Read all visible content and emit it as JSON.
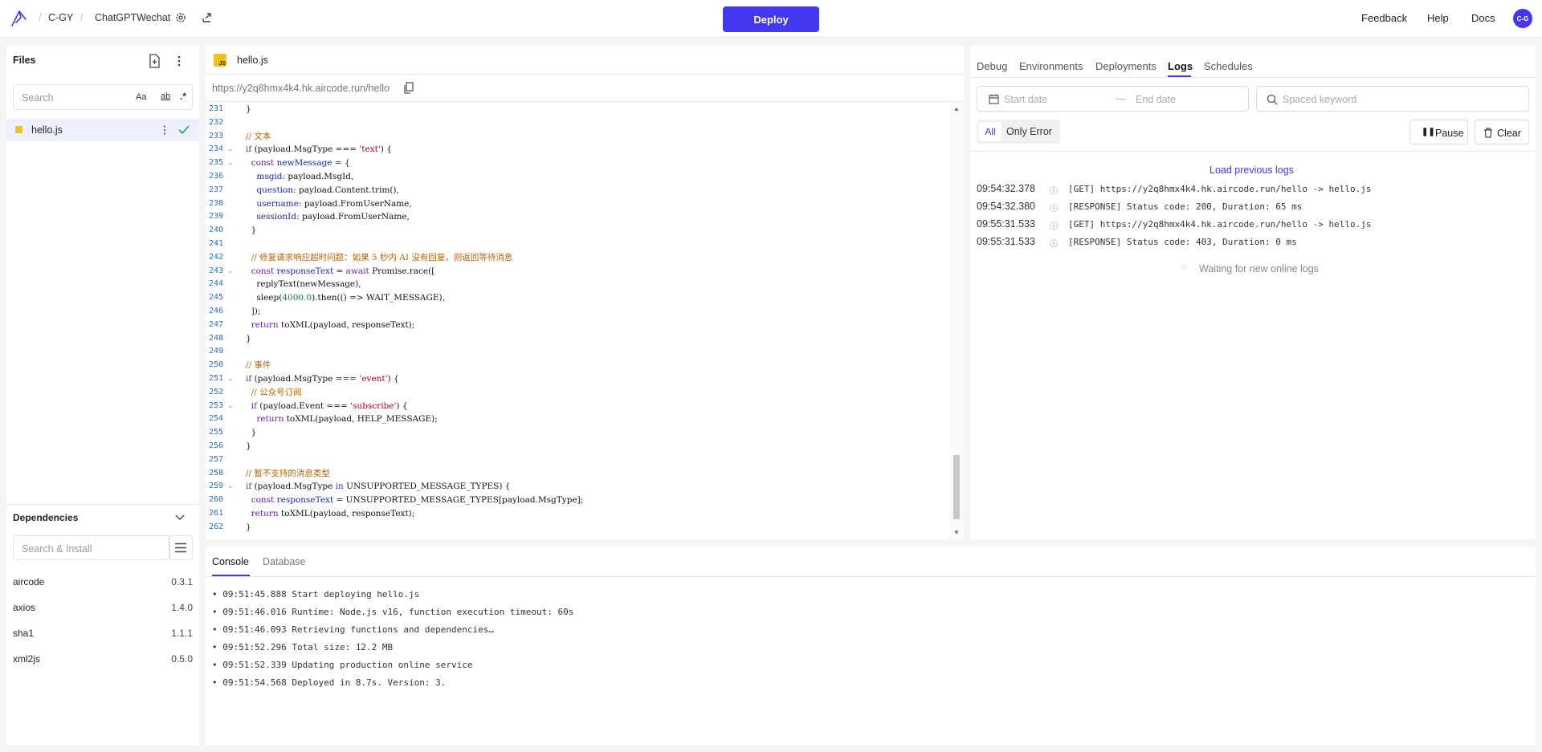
{
  "topbar": {
    "breadcrumb": [
      "C-GY",
      "ChatGPTWechat"
    ],
    "deploy": "Deploy",
    "links": [
      "Feedback",
      "Help",
      "Docs"
    ],
    "avatar": "C-G"
  },
  "files": {
    "title": "Files",
    "search_placeholder": "Search",
    "search_opts": [
      "Aa",
      "ab",
      ".*"
    ],
    "items": [
      {
        "name": "hello.js"
      }
    ]
  },
  "dependencies": {
    "title": "Dependencies",
    "search_placeholder": "Search & Install",
    "items": [
      {
        "name": "aircode",
        "version": "0.3.1"
      },
      {
        "name": "axios",
        "version": "1.4.0"
      },
      {
        "name": "sha1",
        "version": "1.1.1"
      },
      {
        "name": "xml2js",
        "version": "0.5.0"
      }
    ]
  },
  "editor": {
    "tab": "hello.js",
    "tab_badge": "JS",
    "url": "https://y2q8hmx4k4.hk.aircode.run/hello",
    "lines": [
      {
        "n": "231",
        "t": "}"
      },
      {
        "n": "232",
        "t": ""
      },
      {
        "n": "233",
        "t": "// 文本"
      },
      {
        "n": "234",
        "t": "if (payload.MsgType === 'text') {",
        "f": true
      },
      {
        "n": "235",
        "t": "  const newMessage = {",
        "f": true
      },
      {
        "n": "236",
        "t": "    msgid: payload.MsgId,"
      },
      {
        "n": "237",
        "t": "    question: payload.Content.trim(),"
      },
      {
        "n": "238",
        "t": "    username: payload.FromUserName,"
      },
      {
        "n": "239",
        "t": "    sessionId: payload.FromUserName,"
      },
      {
        "n": "240",
        "t": "  }"
      },
      {
        "n": "241",
        "t": ""
      },
      {
        "n": "242",
        "t": "  // 修复请求响应超时问题：如果 5 秒内 AI 没有回复，则返回等待消息"
      },
      {
        "n": "243",
        "t": "  const responseText = await Promise.race([",
        "f": true
      },
      {
        "n": "244",
        "t": "    replyText(newMessage),"
      },
      {
        "n": "245",
        "t": "    sleep(4000.0).then(() => WAIT_MESSAGE),"
      },
      {
        "n": "246",
        "t": "  ]);"
      },
      {
        "n": "247",
        "t": "  return toXML(payload, responseText);"
      },
      {
        "n": "248",
        "t": "}"
      },
      {
        "n": "249",
        "t": ""
      },
      {
        "n": "250",
        "t": "// 事件"
      },
      {
        "n": "251",
        "t": "if (payload.MsgType === 'event') {",
        "f": true
      },
      {
        "n": "252",
        "t": "  // 公众号订阅"
      },
      {
        "n": "253",
        "t": "  if (payload.Event === 'subscribe') {",
        "f": true
      },
      {
        "n": "254",
        "t": "    return toXML(payload, HELP_MESSAGE);"
      },
      {
        "n": "255",
        "t": "  }"
      },
      {
        "n": "256",
        "t": "}"
      },
      {
        "n": "257",
        "t": ""
      },
      {
        "n": "258",
        "t": "// 暂不支持的消息类型"
      },
      {
        "n": "259",
        "t": "if (payload.MsgType in UNSUPPORTED_MESSAGE_TYPES) {",
        "f": true
      },
      {
        "n": "260",
        "t": "  const responseText = UNSUPPORTED_MESSAGE_TYPES[payload.MsgType];"
      },
      {
        "n": "261",
        "t": "  return toXML(payload, responseText);"
      },
      {
        "n": "262",
        "t": "}"
      }
    ]
  },
  "logs_panel": {
    "tabs": [
      "Debug",
      "Environments",
      "Deployments",
      "Logs",
      "Schedules"
    ],
    "active_tab": "Logs",
    "start_placeholder": "Start date",
    "end_placeholder": "End date",
    "keyword_placeholder": "Spaced keyword",
    "filter_all": "All",
    "filter_error": "Only Error",
    "pause": "Pause",
    "clear": "Clear",
    "load_previous": "Load previous logs",
    "entries": [
      {
        "time": "09:54:32.378",
        "msg": "[GET] https://y2q8hmx4k4.hk.aircode.run/hello -> hello.js"
      },
      {
        "time": "09:54:32.380",
        "msg": "[RESPONSE] Status code: 200, Duration: 65 ms"
      },
      {
        "time": "09:55:31.533",
        "msg": "[GET] https://y2q8hmx4k4.hk.aircode.run/hello -> hello.js"
      },
      {
        "time": "09:55:31.533",
        "msg": "[RESPONSE] Status code: 403, Duration: 0 ms"
      }
    ],
    "waiting": "Waiting for new online logs"
  },
  "console": {
    "tabs": [
      "Console",
      "Database"
    ],
    "active_tab": "Console",
    "lines": [
      "09:51:45.888 Start deploying hello.js",
      "09:51:46.016 Runtime: Node.js v16, function execution timeout: 60s",
      "09:51:46.093 Retrieving functions and dependencies…",
      "09:51:52.296 Total size: 12.2 MB",
      "09:51:52.339 Updating production online service",
      "09:51:54.568 Deployed in 8.7s. Version: 3."
    ]
  },
  "colors": {
    "accent": "#4338f0",
    "success": "#22a34a",
    "comment": "#b26400",
    "keyword": "#6a1fb0",
    "string": "#b00018"
  }
}
